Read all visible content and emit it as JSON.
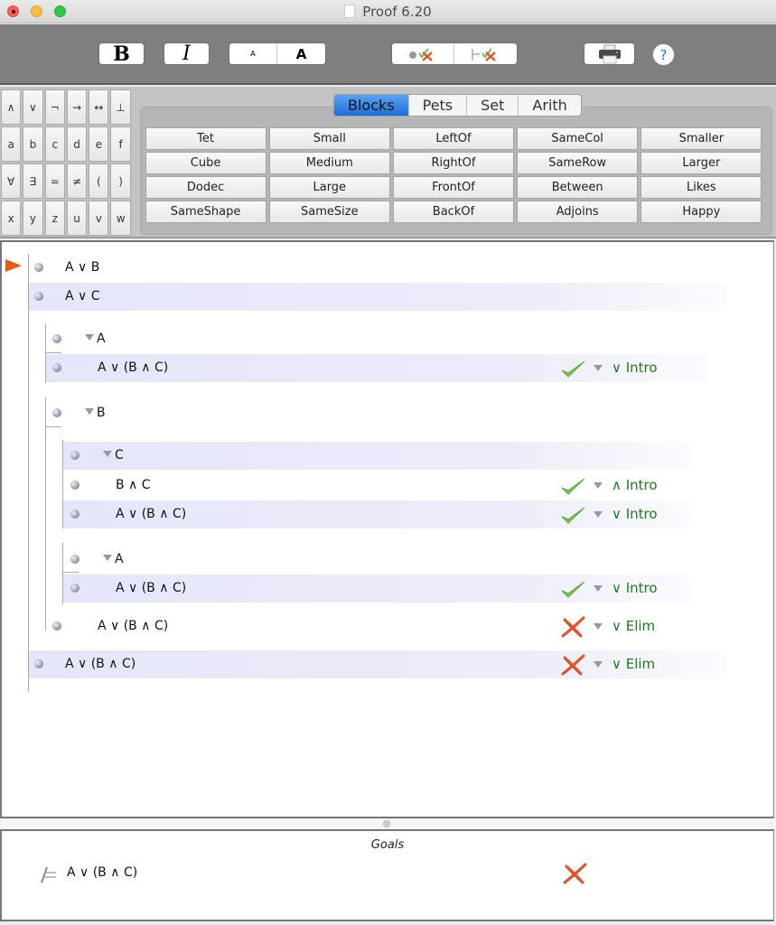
{
  "window": {
    "title": "Proof 6.20",
    "traffic_lights": [
      "close",
      "minimize",
      "maximize"
    ]
  },
  "toolbar": {
    "bold_label": "B",
    "italic_label": "I",
    "font_small_label": "A",
    "font_large_label": "A",
    "verify_step_icon": "bullet-check-cross-icon",
    "verify_all_icon": "turnstile-check-cross-icon",
    "print_icon": "printer-icon",
    "help_label": "?"
  },
  "symbols": [
    "∧",
    "∨",
    "¬",
    "→",
    "↔",
    "⊥",
    "a",
    "b",
    "c",
    "d",
    "e",
    "f",
    "∀",
    "∃",
    "=",
    "≠",
    "(",
    ")",
    "x",
    "y",
    "z",
    "u",
    "v",
    "w"
  ],
  "predicate_tabs": [
    {
      "label": "Blocks",
      "active": true
    },
    {
      "label": "Pets",
      "active": false
    },
    {
      "label": "Set",
      "active": false
    },
    {
      "label": "Arith",
      "active": false
    }
  ],
  "predicates": [
    "Tet",
    "Small",
    "LeftOf",
    "SameCol",
    "Smaller",
    "Cube",
    "Medium",
    "RightOf",
    "SameRow",
    "Larger",
    "Dodec",
    "Large",
    "FrontOf",
    "Between",
    "Likes",
    "SameShape",
    "SameSize",
    "BackOf",
    "Adjoins",
    "Happy"
  ],
  "proof": {
    "lines": [
      {
        "text": "A ∨ B",
        "kind": "premise",
        "current": true
      },
      {
        "text": "A ∨ C",
        "kind": "premise"
      },
      {
        "text": "A",
        "kind": "assumption"
      },
      {
        "text": "A ∨ (B ∧ C)",
        "status": "valid",
        "rule": "∨ Intro"
      },
      {
        "text": "B",
        "kind": "assumption"
      },
      {
        "text": "C",
        "kind": "assumption"
      },
      {
        "text": "B ∧ C",
        "status": "valid",
        "rule": "∧ Intro"
      },
      {
        "text": "A ∨ (B ∧ C)",
        "status": "valid",
        "rule": "∨ Intro"
      },
      {
        "text": "A",
        "kind": "assumption"
      },
      {
        "text": "A ∨ (B ∧ C)",
        "status": "valid",
        "rule": "∨ Intro"
      },
      {
        "text": "A ∨ (B ∧ C)",
        "status": "invalid",
        "rule": "∨ Elim"
      },
      {
        "text": "A ∨ (B ∧ C)",
        "status": "invalid",
        "rule": "∨ Elim"
      }
    ]
  },
  "goals": {
    "title": "Goals",
    "items": [
      {
        "text": "A ∨ (B ∧ C)",
        "status": "invalid"
      }
    ]
  },
  "colors": {
    "rule_text": "#1f7a1f",
    "check": "#7ec850",
    "cross": "#e0532a",
    "active_tab": "#2b7de3",
    "pointer": "#e85a14"
  }
}
